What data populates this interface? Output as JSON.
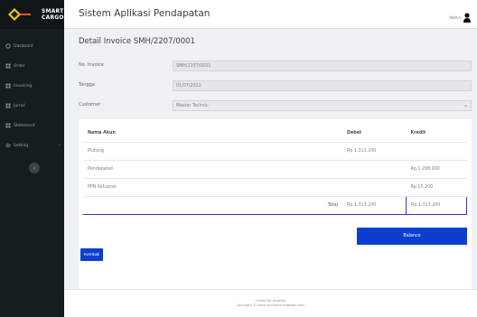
{
  "brand": {
    "name_line1": "SMART",
    "name_line2": "CARGO"
  },
  "sidebar": {
    "items": [
      {
        "label": "Dasboard",
        "icon": "dashboard-icon"
      },
      {
        "label": "Order",
        "icon": "grid-icon"
      },
      {
        "label": "Invoicing",
        "icon": "grid-icon"
      },
      {
        "label": "Jurnal",
        "icon": "grid-icon"
      },
      {
        "label": "Statement",
        "icon": "grid-icon"
      },
      {
        "label": "Setting",
        "icon": "gear-icon"
      }
    ],
    "toggle_icon": "chevron-left-icon"
  },
  "header": {
    "title": "Sistem Aplikasi Pendapatan",
    "user_name": "Admin"
  },
  "page": {
    "title": "Detail Invoice SMH/2207/0001"
  },
  "form": {
    "invoice_no": {
      "label": "No. Invoice",
      "value": "SMH/2207/0001"
    },
    "date": {
      "label": "Tangga",
      "value": "01/07/2022"
    },
    "customer": {
      "label": "Customer",
      "value": "Master Technic"
    }
  },
  "journal": {
    "headers": {
      "account": "Nama Akun",
      "debit": "Debet",
      "credit": "Kredit"
    },
    "rows": [
      {
        "account": "Piutang",
        "debit": "Rp 1.313.200",
        "credit": ""
      },
      {
        "account": "Pendapatan",
        "debit": "",
        "credit": "Rp 1.298.000"
      },
      {
        "account": "PPN Keluaran",
        "debit": "",
        "credit": "Rp 15.200"
      }
    ],
    "total": {
      "label": "Total",
      "debit": "Rp 1.313.200",
      "credit": "Rp 1.313.200"
    },
    "status": "Balance"
  },
  "actions": {
    "back_label": "Kembali"
  },
  "footer": {
    "line1": "Create By: Nuraliya",
    "line2": "Copyright © https://nuraliya.blogspot.com/"
  },
  "colors": {
    "accent": "#0c3fcf",
    "sidebar": "#161d21",
    "logo_yellow": "#f3c316",
    "logo_orange": "#e6561e"
  }
}
